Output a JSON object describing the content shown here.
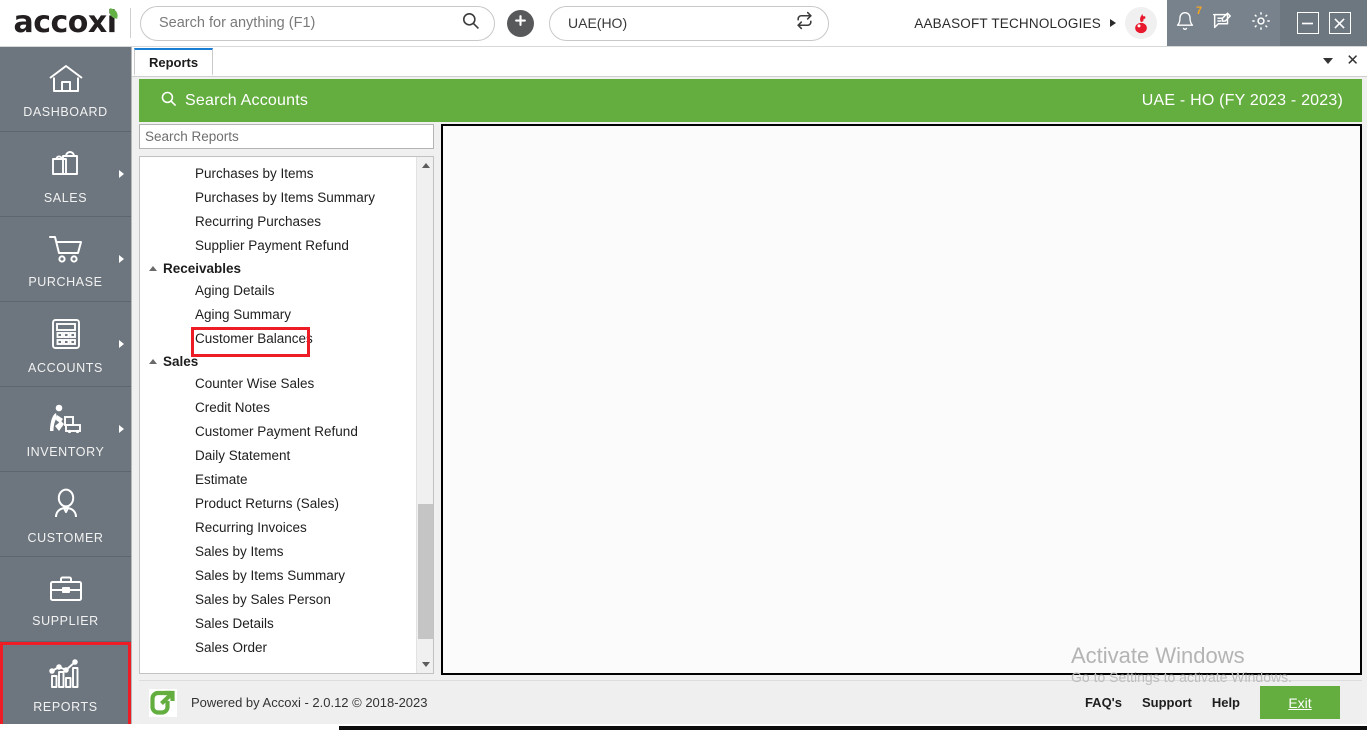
{
  "app": {
    "logo_text": "accoxi",
    "brand_green": "#63ae3f",
    "highlight_red": "#ee1c24",
    "nav_bg": "#6d767e"
  },
  "topbar": {
    "search_placeholder": "Search for anything (F1)",
    "search_value": "",
    "search_icon": "search-icon",
    "add_icon": "plus-icon",
    "branch_value": "UAE(HO)",
    "branch_switch_icon": "switch-branch-icon",
    "org_name": "AABASOFT TECHNOLOGIES",
    "org_caret_icon": "caret-right-icon",
    "avatar_icon": "user-avatar",
    "icons": [
      {
        "name": "notification-bell-icon",
        "badge": "7"
      },
      {
        "name": "messages-icon",
        "badge": ""
      },
      {
        "name": "settings-gear-icon",
        "badge": ""
      }
    ],
    "window_controls": [
      {
        "name": "minimize-button",
        "glyph": "—"
      },
      {
        "name": "close-button",
        "glyph": "✕"
      }
    ]
  },
  "sidebar": {
    "items": [
      {
        "label": "DASHBOARD",
        "icon": "home-icon",
        "has_submenu": false,
        "highlighted": false
      },
      {
        "label": "SALES",
        "icon": "shopping-bag-icon",
        "has_submenu": true,
        "highlighted": false
      },
      {
        "label": "PURCHASE",
        "icon": "shopping-cart-icon",
        "has_submenu": true,
        "highlighted": false
      },
      {
        "label": "ACCOUNTS",
        "icon": "calculator-icon",
        "has_submenu": true,
        "highlighted": false
      },
      {
        "label": "INVENTORY",
        "icon": "warehouse-worker-icon",
        "has_submenu": true,
        "highlighted": false
      },
      {
        "label": "CUSTOMER",
        "icon": "person-icon",
        "has_submenu": false,
        "highlighted": false
      },
      {
        "label": "SUPPLIER",
        "icon": "briefcase-icon",
        "has_submenu": false,
        "highlighted": false
      },
      {
        "label": "REPORTS",
        "icon": "bar-chart-icon",
        "has_submenu": false,
        "highlighted": true
      }
    ]
  },
  "tabbar": {
    "tabs": [
      {
        "label": "Reports",
        "active": true
      }
    ],
    "dropdown_icon": "chevron-down-icon",
    "close_icon": "close-icon"
  },
  "header": {
    "search_icon": "search-icon",
    "title": "Search Accounts",
    "fiscal_year": "UAE - HO (FY 2023 - 2023)"
  },
  "reports_panel": {
    "search_placeholder": "Search Reports",
    "search_value": "",
    "groups": [
      {
        "name": "",
        "collapsible": false,
        "items": [
          {
            "label": "Purchases by Items",
            "selected": false
          },
          {
            "label": "Purchases by Items Summary",
            "selected": false
          },
          {
            "label": "Recurring Purchases",
            "selected": false
          },
          {
            "label": "Supplier Payment Refund",
            "selected": false
          }
        ]
      },
      {
        "name": "Receivables",
        "collapsible": true,
        "items": [
          {
            "label": "Aging Details",
            "selected": false
          },
          {
            "label": "Aging Summary",
            "selected": false
          },
          {
            "label": "Customer Balances",
            "selected": true
          }
        ]
      },
      {
        "name": "Sales",
        "collapsible": true,
        "items": [
          {
            "label": "Counter Wise Sales",
            "selected": false
          },
          {
            "label": "Credit Notes",
            "selected": false
          },
          {
            "label": "Customer Payment Refund",
            "selected": false
          },
          {
            "label": "Daily Statement",
            "selected": false
          },
          {
            "label": "Estimate",
            "selected": false
          },
          {
            "label": "Product Returns (Sales)",
            "selected": false
          },
          {
            "label": "Recurring Invoices",
            "selected": false
          },
          {
            "label": "Sales by Items",
            "selected": false
          },
          {
            "label": "Sales by Items Summary",
            "selected": false
          },
          {
            "label": "Sales by Sales Person",
            "selected": false
          },
          {
            "label": "Sales Details",
            "selected": false
          },
          {
            "label": "Sales Order",
            "selected": false
          }
        ]
      }
    ],
    "scroll_up_icon": "scroll-up-arrow-icon",
    "scroll_down_icon": "scroll-down-arrow-icon"
  },
  "footer": {
    "logo_icon": "accoxi-arrow-logo",
    "powered_by": "Powered by Accoxi - 2.0.12 © 2018-2023",
    "links": [
      "FAQ's",
      "Support",
      "Help"
    ],
    "exit_label": "Exit"
  },
  "watermark": {
    "title": "Activate Windows",
    "subtitle": "Go to Settings to activate Windows."
  }
}
